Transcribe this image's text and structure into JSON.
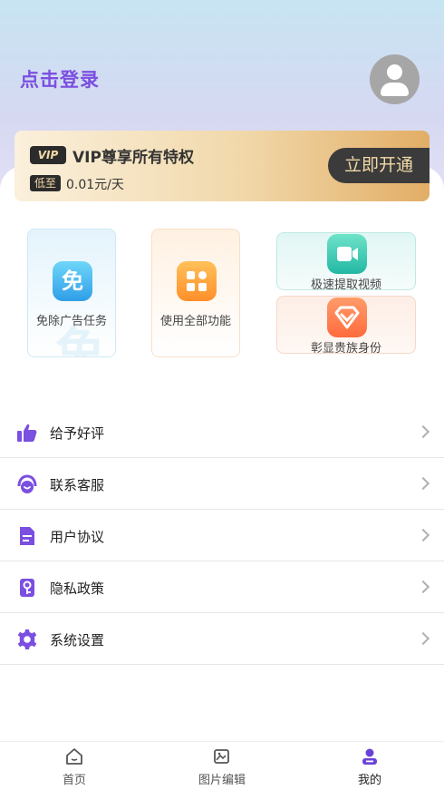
{
  "header": {
    "login_text": "点击登录",
    "avatar_icon": "user-avatar-icon"
  },
  "vip": {
    "badge": "VIP",
    "title": "VIP尊享所有特权",
    "low_badge": "低至",
    "price": "0.01元/天",
    "open_button": "立即开通",
    "colors": {
      "card_start": "#fbf0dc",
      "card_end": "#e2ae66",
      "button": "#3b3b3b"
    }
  },
  "features": {
    "free_ads": {
      "icon_text": "免",
      "label": "免除广告任务"
    },
    "all_features": {
      "label": "使用全部功能"
    },
    "extract_video": {
      "label": "极速提取视频"
    },
    "noble_identity": {
      "label": "彰显贵族身份"
    }
  },
  "menu": [
    {
      "label": "给予好评",
      "icon": "thumbs-up-icon"
    },
    {
      "label": "联系客服",
      "icon": "headset-icon"
    },
    {
      "label": "用户协议",
      "icon": "document-icon"
    },
    {
      "label": "隐私政策",
      "icon": "privacy-lock-icon"
    },
    {
      "label": "系统设置",
      "icon": "gear-icon"
    }
  ],
  "tabbar": [
    {
      "label": "首页",
      "icon": "home-icon"
    },
    {
      "label": "图片编辑",
      "icon": "image-edit-icon"
    },
    {
      "label": "我的",
      "icon": "profile-icon",
      "active": true
    }
  ],
  "accent_color": "#7b4fe0"
}
